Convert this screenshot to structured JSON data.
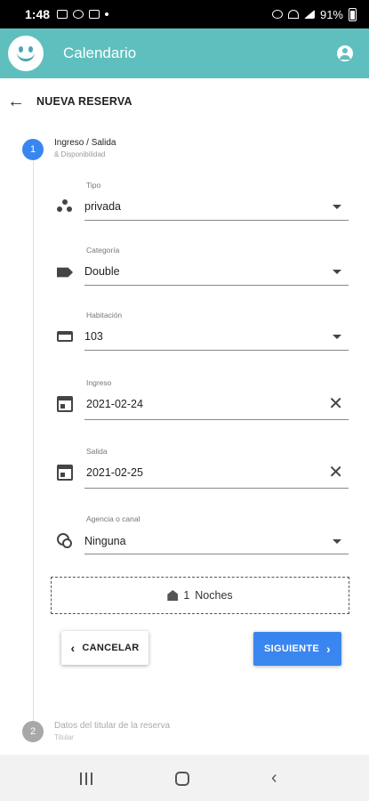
{
  "status_bar": {
    "time": "1:48",
    "battery": "91%"
  },
  "app_bar": {
    "title": "Calendario"
  },
  "header": {
    "title": "NUEVA RESERVA"
  },
  "steps": [
    {
      "number": "1",
      "title": "Ingreso / Salida",
      "subtitle": "& Disponibilidad"
    },
    {
      "number": "2",
      "title": "Datos del titular de la reserva",
      "subtitle": "Titular"
    }
  ],
  "fields": {
    "tipo": {
      "label": "Tipo",
      "value": "privada"
    },
    "categoria": {
      "label": "Categoría",
      "value": "Double"
    },
    "habitacion": {
      "label": "Habitación",
      "value": "103"
    },
    "ingreso": {
      "label": "Ingreso",
      "value": "2021-02-24"
    },
    "salida": {
      "label": "Salida",
      "value": "2021-02-25"
    },
    "agencia": {
      "label": "Agencia o canal",
      "value": "Ninguna"
    }
  },
  "nights": {
    "count": "1",
    "label": "Noches"
  },
  "buttons": {
    "cancel": "CANCELAR",
    "next": "SIGUIENTE"
  },
  "colors": {
    "app_bar": "#5fbfbf",
    "primary": "#3a86f0",
    "step_inactive": "#a8a8a8"
  }
}
